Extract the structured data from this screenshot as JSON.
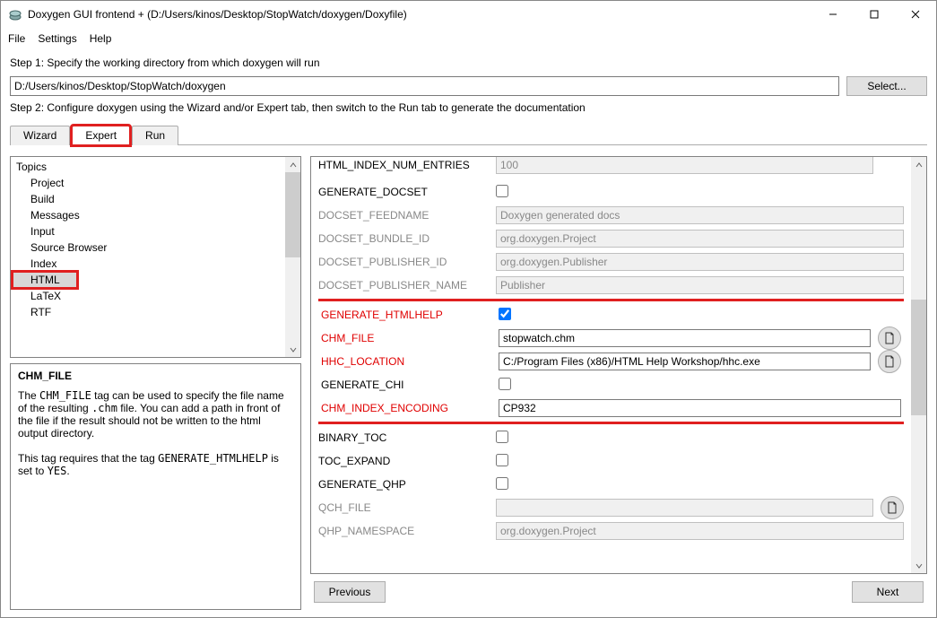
{
  "window": {
    "title": "Doxygen GUI frontend + (D:/Users/kinos/Desktop/StopWatch/doxygen/Doxyfile)"
  },
  "menu": {
    "file": "File",
    "settings": "Settings",
    "help": "Help"
  },
  "step1": {
    "label": "Step 1: Specify the working directory from which doxygen will run",
    "path": "D:/Users/kinos/Desktop/StopWatch/doxygen",
    "select": "Select..."
  },
  "step2": {
    "label": "Step 2: Configure doxygen using the Wizard and/or Expert tab, then switch to the Run tab to generate the documentation"
  },
  "tabs": {
    "wizard": "Wizard",
    "expert": "Expert",
    "run": "Run"
  },
  "topics": {
    "header": "Topics",
    "items": [
      "Project",
      "Build",
      "Messages",
      "Input",
      "Source Browser",
      "Index",
      "HTML",
      "LaTeX",
      "RTF"
    ],
    "selected": "HTML"
  },
  "help": {
    "title": "CHM_FILE",
    "p1a": "The ",
    "p1code1": "CHM_FILE",
    "p1b": " tag can be used to specify the file name of the resulting ",
    "p1code2": ".chm",
    "p1c": " file. You can add a path in front of the file if the result should not be written to the html output directory.",
    "p2a": "This tag requires that the tag ",
    "p2code1": "GENERATE_HTMLHELP",
    "p2b": " is set to ",
    "p2code2": "YES",
    "p2c": "."
  },
  "options": {
    "cutoff_label": "HTML_INDEX_NUM_ENTRIES",
    "cutoff_value": "100",
    "generate_docset": {
      "label": "GENERATE_DOCSET"
    },
    "docset_feedname": {
      "label": "DOCSET_FEEDNAME",
      "value": "Doxygen generated docs"
    },
    "docset_bundle_id": {
      "label": "DOCSET_BUNDLE_ID",
      "value": "org.doxygen.Project"
    },
    "docset_publisher_id": {
      "label": "DOCSET_PUBLISHER_ID",
      "value": "org.doxygen.Publisher"
    },
    "docset_publisher_name": {
      "label": "DOCSET_PUBLISHER_NAME",
      "value": "Publisher"
    },
    "generate_htmlhelp": {
      "label": "GENERATE_HTMLHELP"
    },
    "chm_file": {
      "label": "CHM_FILE",
      "value": "stopwatch.chm"
    },
    "hhc_location": {
      "label": "HHC_LOCATION",
      "value": "C:/Program Files (x86)/HTML Help Workshop/hhc.exe"
    },
    "generate_chi": {
      "label": "GENERATE_CHI"
    },
    "chm_index_encoding": {
      "label": "CHM_INDEX_ENCODING",
      "value": "CP932"
    },
    "binary_toc": {
      "label": "BINARY_TOC"
    },
    "toc_expand": {
      "label": "TOC_EXPAND"
    },
    "generate_qhp": {
      "label": "GENERATE_QHP"
    },
    "qch_file": {
      "label": "QCH_FILE",
      "value": ""
    },
    "qhp_namespace": {
      "label": "QHP_NAMESPACE",
      "value": "org.doxygen.Project"
    }
  },
  "nav": {
    "prev": "Previous",
    "next": "Next"
  }
}
